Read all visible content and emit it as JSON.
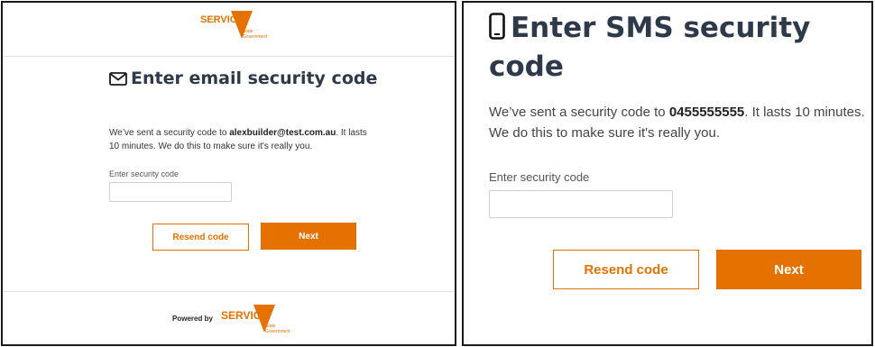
{
  "brand": {
    "logo_word": "SERVICE",
    "logo_sub_line1": "State",
    "logo_sub_line2": "Government",
    "accent_color": "#e57200"
  },
  "email_screen": {
    "icon": "envelope-icon",
    "title": "Enter email security code",
    "message_prefix": "We’ve sent a security code to ",
    "email": "alexbuilder@test.com.au",
    "message_suffix": ". It lasts 10 minutes. We do this to make sure it's really you.",
    "field_label": "Enter security code",
    "field_value": "",
    "resend_label": "Resend code",
    "next_label": "Next",
    "footer_powered_by": "Powered by"
  },
  "sms_screen": {
    "icon": "mobile-phone-icon",
    "title": "Enter SMS security code",
    "message_prefix": "We’ve sent a security code to ",
    "phone": "0455555555",
    "message_suffix": ". It lasts 10 minutes. We do this to make sure it's really you.",
    "field_label": "Enter security code",
    "field_value": "",
    "resend_label": "Resend code",
    "next_label": "Next"
  }
}
